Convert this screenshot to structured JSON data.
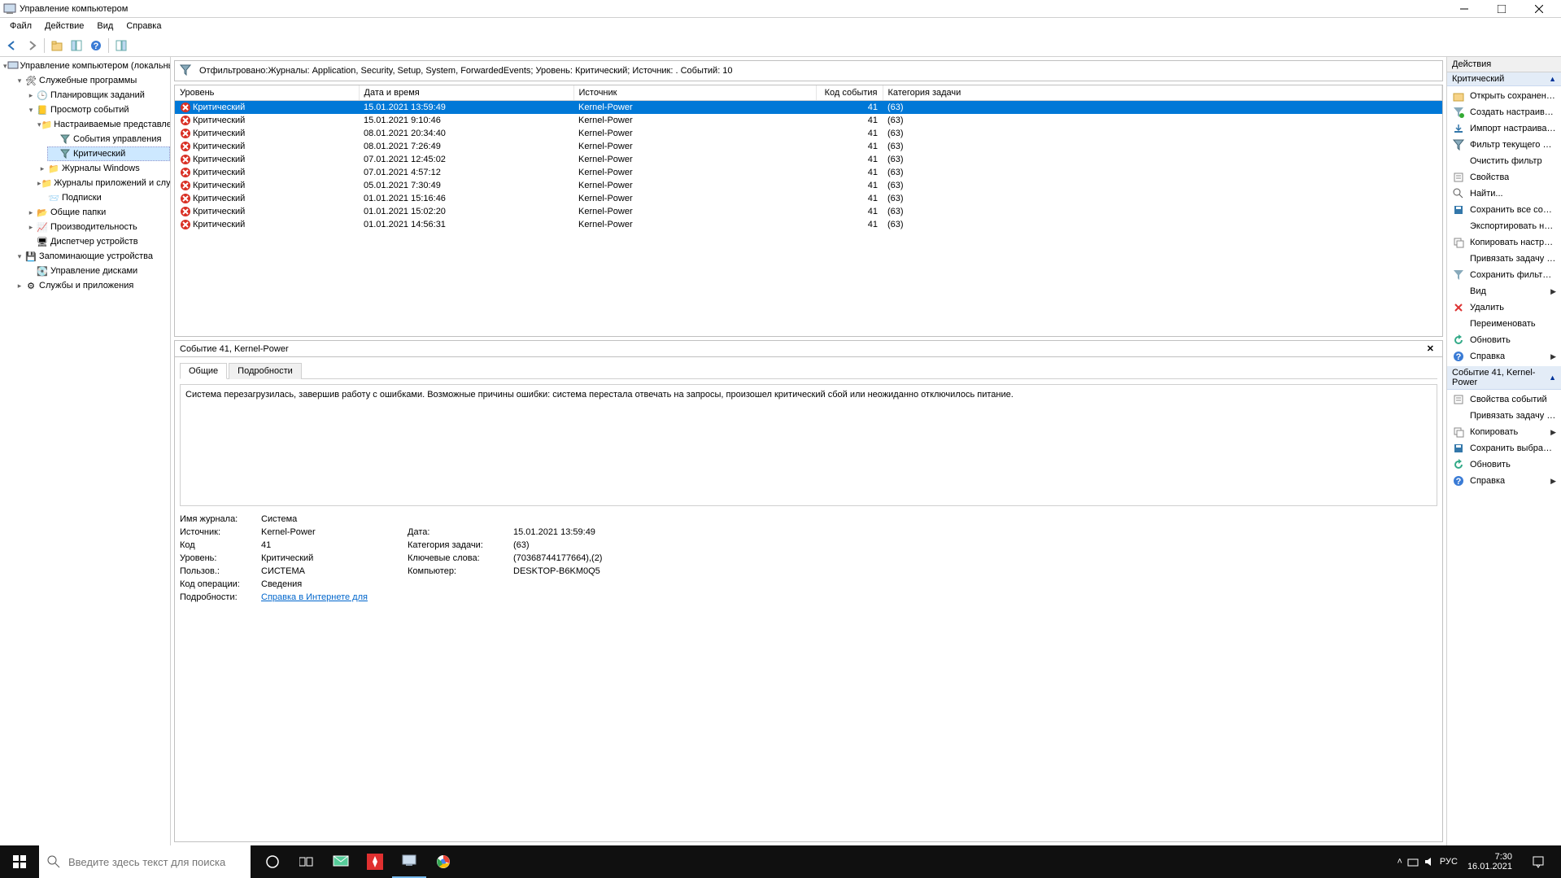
{
  "window": {
    "title": "Управление компьютером"
  },
  "menu": [
    "Файл",
    "Действие",
    "Вид",
    "Справка"
  ],
  "tree": {
    "root": "Управление компьютером (локальным)",
    "system_tools": "Служебные программы",
    "task_scheduler": "Планировщик заданий",
    "event_viewer": "Просмотр событий",
    "custom_views": "Настраиваемые представления",
    "admin_events": "События управления",
    "critical": "Критический",
    "windows_logs": "Журналы Windows",
    "app_svc_logs": "Журналы приложений и служб",
    "subscriptions": "Подписки",
    "shared_folders": "Общие папки",
    "performance": "Производительность",
    "device_manager": "Диспетчер устройств",
    "storage": "Запоминающие устройства",
    "disk_mgmt": "Управление дисками",
    "services_apps": "Службы и приложения"
  },
  "filterText": "Отфильтровано:Журналы: Application, Security, Setup, System, ForwardedEvents; Уровень: Критический; Источник: . Событий: 10",
  "columns": {
    "level": "Уровень",
    "date": "Дата и время",
    "source": "Источник",
    "code": "Код события",
    "category": "Категория задачи"
  },
  "events": [
    {
      "level": "Критический",
      "date": "15.01.2021 13:59:49",
      "source": "Kernel-Power",
      "code": "41",
      "category": "(63)",
      "selected": true
    },
    {
      "level": "Критический",
      "date": "15.01.2021 9:10:46",
      "source": "Kernel-Power",
      "code": "41",
      "category": "(63)"
    },
    {
      "level": "Критический",
      "date": "08.01.2021 20:34:40",
      "source": "Kernel-Power",
      "code": "41",
      "category": "(63)"
    },
    {
      "level": "Критический",
      "date": "08.01.2021 7:26:49",
      "source": "Kernel-Power",
      "code": "41",
      "category": "(63)"
    },
    {
      "level": "Критический",
      "date": "07.01.2021 12:45:02",
      "source": "Kernel-Power",
      "code": "41",
      "category": "(63)"
    },
    {
      "level": "Критический",
      "date": "07.01.2021 4:57:12",
      "source": "Kernel-Power",
      "code": "41",
      "category": "(63)"
    },
    {
      "level": "Критический",
      "date": "05.01.2021 7:30:49",
      "source": "Kernel-Power",
      "code": "41",
      "category": "(63)"
    },
    {
      "level": "Критический",
      "date": "01.01.2021 15:16:46",
      "source": "Kernel-Power",
      "code": "41",
      "category": "(63)"
    },
    {
      "level": "Критический",
      "date": "01.01.2021 15:02:20",
      "source": "Kernel-Power",
      "code": "41",
      "category": "(63)"
    },
    {
      "level": "Критический",
      "date": "01.01.2021 14:56:31",
      "source": "Kernel-Power",
      "code": "41",
      "category": "(63)"
    }
  ],
  "details": {
    "header": "Событие 41, Kernel-Power",
    "tabs": {
      "general": "Общие",
      "details": "Подробности"
    },
    "description": "Система перезагрузилась, завершив работу с ошибками. Возможные причины ошибки: система перестала отвечать на запросы, произошел критический сбой или неожиданно отключилось питание.",
    "props": {
      "logname_l": "Имя журнала:",
      "logname_v": "Система",
      "source_l": "Источник:",
      "source_v": "Kernel-Power",
      "date_l": "Дата:",
      "date_v": "15.01.2021 13:59:49",
      "code_l": "Код",
      "code_v": "41",
      "cat_l": "Категория задачи:",
      "cat_v": "(63)",
      "level_l": "Уровень:",
      "level_v": "Критический",
      "kw_l": "Ключевые слова:",
      "kw_v": "(70368744177664),(2)",
      "user_l": "Пользов.:",
      "user_v": "СИСТЕМА",
      "comp_l": "Компьютер:",
      "comp_v": "DESKTOP-B6KM0Q5",
      "op_l": "Код операции:",
      "op_v": "Сведения",
      "more_l": "Подробности:",
      "more_link": "Справка в Интернете для "
    }
  },
  "actions": {
    "title": "Действия",
    "section1": "Критический",
    "items1": [
      {
        "label": "Открыть сохраненны...",
        "icon": "open"
      },
      {
        "label": "Создать настраивае...",
        "icon": "filter-new"
      },
      {
        "label": "Импорт настраивае...",
        "icon": "import"
      },
      {
        "label": "Фильтр текущего наст...",
        "icon": "filter"
      },
      {
        "label": "Очистить фильтр",
        "icon": "clear"
      },
      {
        "label": "Свойства",
        "icon": "props"
      },
      {
        "label": "Найти...",
        "icon": "find"
      },
      {
        "label": "Сохранить все событ...",
        "icon": "save"
      },
      {
        "label": "Экспортировать настр...",
        "icon": "export"
      },
      {
        "label": "Копировать настраив...",
        "icon": "copy"
      },
      {
        "label": "Привязать задачу к н...",
        "icon": "attach"
      },
      {
        "label": "Сохранить фильтр в н...",
        "icon": "savefilter"
      },
      {
        "label": "Вид",
        "icon": "view",
        "arrow": true
      },
      {
        "label": "Удалить",
        "icon": "delete"
      },
      {
        "label": "Переименовать",
        "icon": "rename"
      },
      {
        "label": "Обновить",
        "icon": "refresh"
      },
      {
        "label": "Справка",
        "icon": "help",
        "arrow": true
      }
    ],
    "section2": "Событие 41, Kernel-Power",
    "items2": [
      {
        "label": "Свойства событий",
        "icon": "props"
      },
      {
        "label": "Привязать задачу к со...",
        "icon": "attach"
      },
      {
        "label": "Копировать",
        "icon": "copy",
        "arrow": true
      },
      {
        "label": "Сохранить выбранны...",
        "icon": "save"
      },
      {
        "label": "Обновить",
        "icon": "refresh"
      },
      {
        "label": "Справка",
        "icon": "help",
        "arrow": true
      }
    ]
  },
  "taskbar": {
    "search_placeholder": "Введите здесь текст для поиска",
    "lang": "РУС",
    "time": "7:30",
    "date": "16.01.2021"
  }
}
